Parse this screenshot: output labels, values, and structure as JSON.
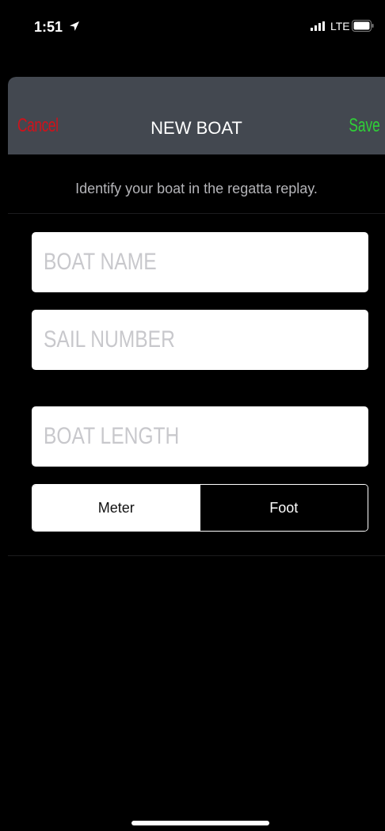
{
  "status_bar": {
    "time": "1:51",
    "network": "LTE"
  },
  "nav": {
    "cancel_label": "Cancel",
    "title": "NEW BOAT",
    "save_label": "Save"
  },
  "subtitle": "Identify your boat in the regatta replay.",
  "form": {
    "boat_name": {
      "value": "",
      "placeholder": "BOAT NAME"
    },
    "sail_number": {
      "value": "",
      "placeholder": "SAIL NUMBER"
    },
    "boat_length": {
      "value": "",
      "placeholder": "BOAT LENGTH"
    }
  },
  "units": {
    "options": [
      "Meter",
      "Foot"
    ],
    "selected": "Meter"
  },
  "colors": {
    "cancel": "#d0121b",
    "save": "#2fd037",
    "nav_bg": "#434850"
  },
  "icons": [
    "location-arrow-icon",
    "signal-icon",
    "battery-icon"
  ]
}
